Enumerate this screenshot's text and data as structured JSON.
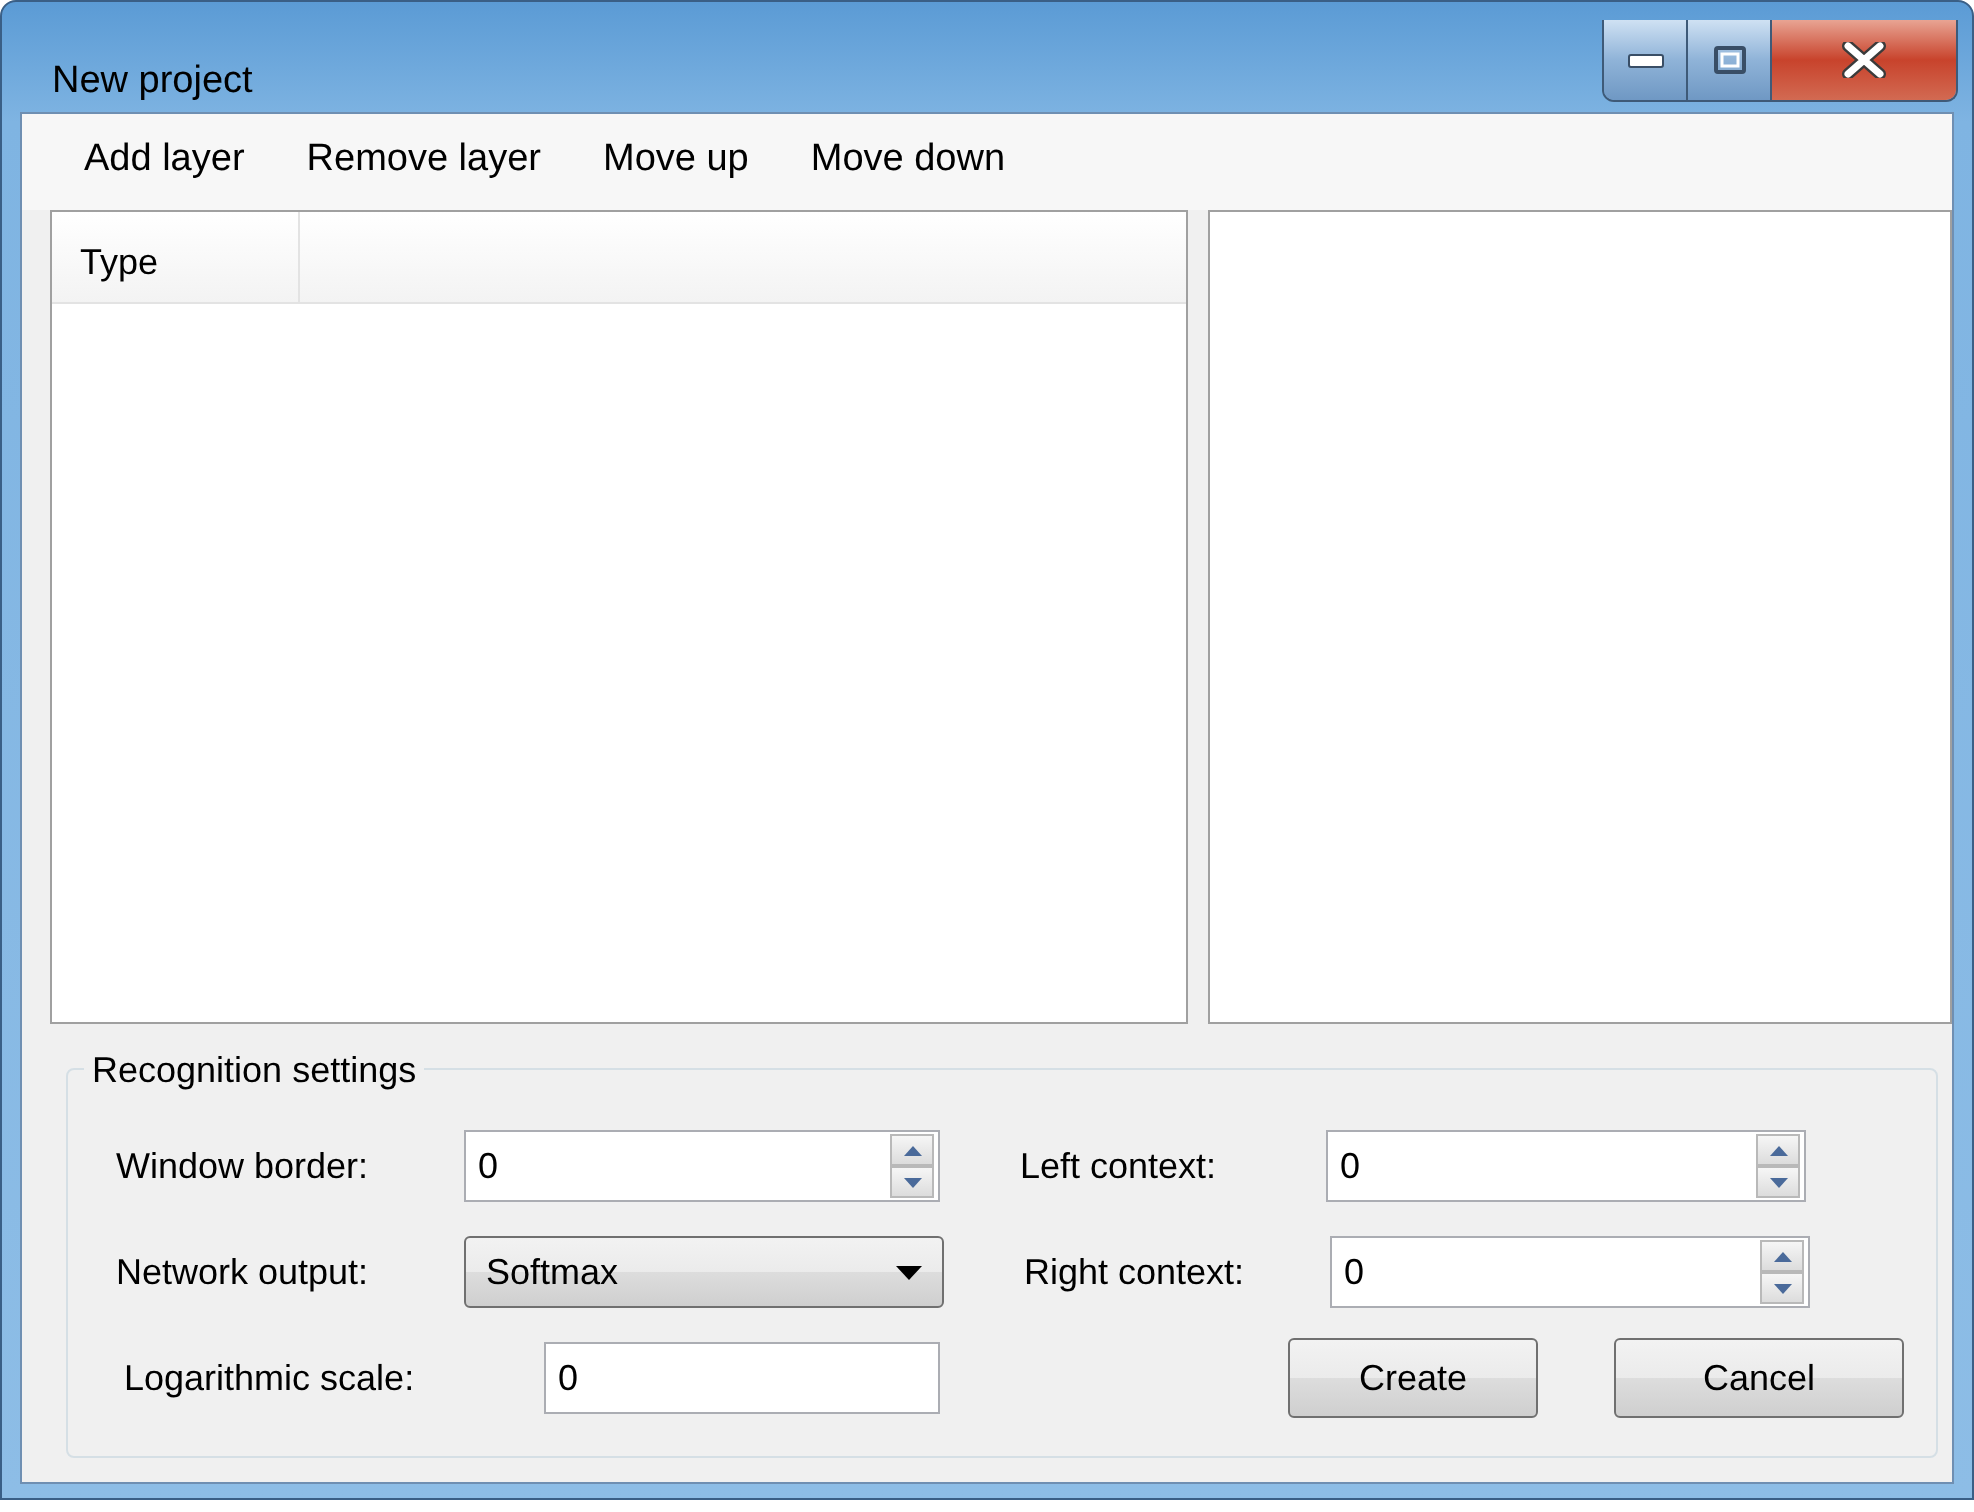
{
  "window": {
    "title": "New project"
  },
  "toolbar": [
    "Add layer",
    "Remove layer",
    "Move up",
    "Move down"
  ],
  "layer_list": {
    "columns": [
      "Type"
    ]
  },
  "recognition_settings": {
    "title": "Recognition settings",
    "fields": [
      {
        "label": "Window border:",
        "kind": "spinner",
        "value": "0"
      },
      {
        "label": "Left context:",
        "kind": "spinner",
        "value": "0"
      },
      {
        "label": "Network output:",
        "kind": "dropdown",
        "value": "Softmax"
      },
      {
        "label": "Right context:",
        "kind": "spinner",
        "value": "0"
      },
      {
        "label": "Logarithmic scale:",
        "kind": "text",
        "value": "0"
      }
    ]
  },
  "buttons": [
    "Create",
    "Cancel"
  ]
}
